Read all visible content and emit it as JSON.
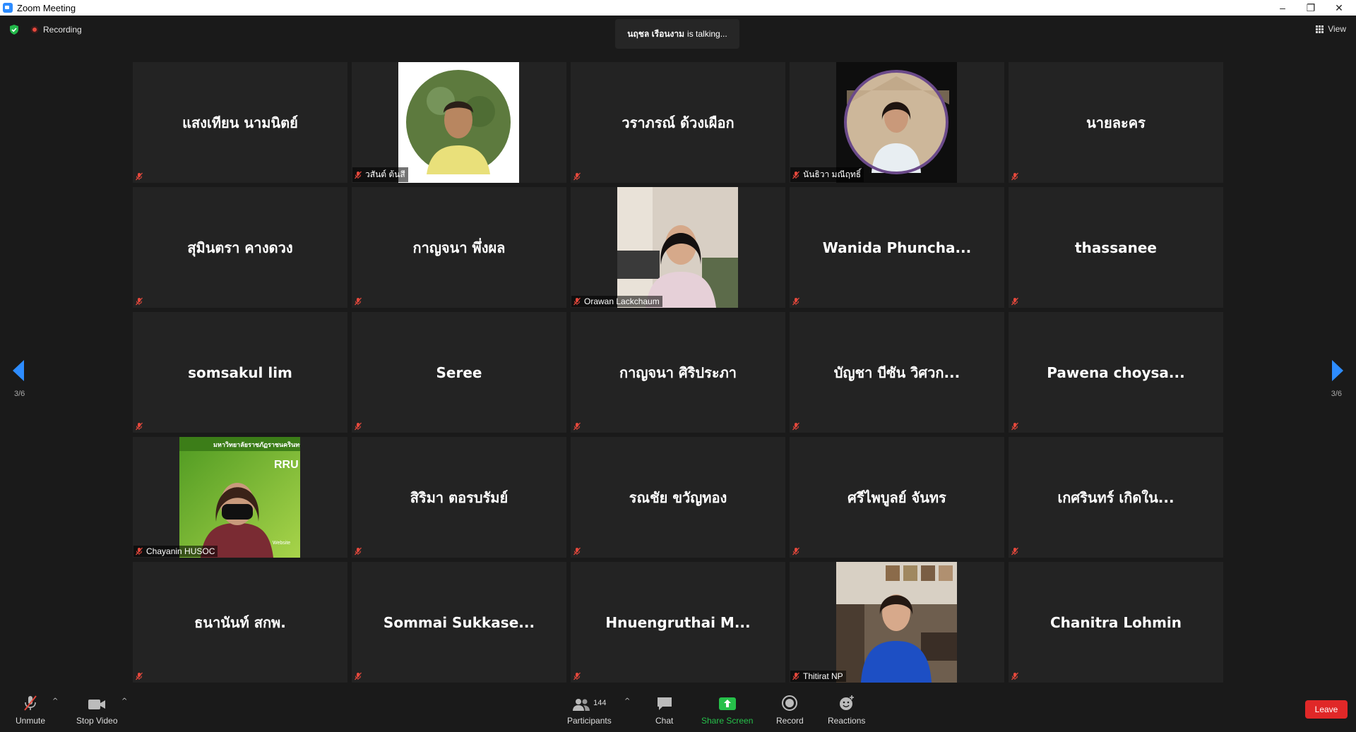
{
  "window": {
    "title": "Zoom Meeting"
  },
  "status": {
    "recording": "Recording",
    "talking_name": "นฤชล เรือนงาม",
    "talking_suffix": "is talking...",
    "view": "View"
  },
  "pagination": {
    "left": "3/6",
    "right": "3/6"
  },
  "tiles": [
    {
      "name": "แสงเทียน นามนิตย์"
    },
    {
      "label": "วสันต์ ต้นสี"
    },
    {
      "name": "วราภรณ์ ด้วงเผือก"
    },
    {
      "label": "นันธิวา มณีฤทธิ์"
    },
    {
      "name": "นายละคร"
    },
    {
      "name": "สุมินตรา คางดวง"
    },
    {
      "name": "กาญจนา พึ่งผล"
    },
    {
      "label": "Orawan Lackchaum"
    },
    {
      "name": "Wanida Phuncha..."
    },
    {
      "name": "thassanee"
    },
    {
      "name": "somsakul lim"
    },
    {
      "name": "Seree"
    },
    {
      "name": "กาญจนา ศิริประภา"
    },
    {
      "name": "บัญชา บีซัน วิศวก..."
    },
    {
      "name": "Pawena choysa..."
    },
    {
      "label": "Chayanin HUSOC"
    },
    {
      "name": "สิริมา ตอรบรัมย์"
    },
    {
      "name": "รณชัย ขวัญทอง"
    },
    {
      "name": "ศรีไพบูลย์ จันทร"
    },
    {
      "name": "เกศรินทร์ เกิดใน..."
    },
    {
      "name": "ธนานันท์ สกพ."
    },
    {
      "name": "Sommai Sukkase..."
    },
    {
      "name": "Hnuengruthai M..."
    },
    {
      "label": "Thitirat NP"
    },
    {
      "name": "Chanitra Lohmin"
    }
  ],
  "chayanin_banner": {
    "university": "มหาวิทยาลัยราชภัฏราชนครินทร์",
    "logo": "RRU",
    "website": "Website"
  },
  "toolbar": {
    "unmute": "Unmute",
    "stop_video": "Stop Video",
    "participants": "Participants",
    "participants_count": "144",
    "chat": "Chat",
    "share_screen": "Share Screen",
    "record": "Record",
    "reactions": "Reactions",
    "leave": "Leave"
  },
  "colors": {
    "accent": "#2d8cff",
    "share_green": "#26c04a",
    "leave_red": "#e02828",
    "muted_red": "#e5483c"
  }
}
